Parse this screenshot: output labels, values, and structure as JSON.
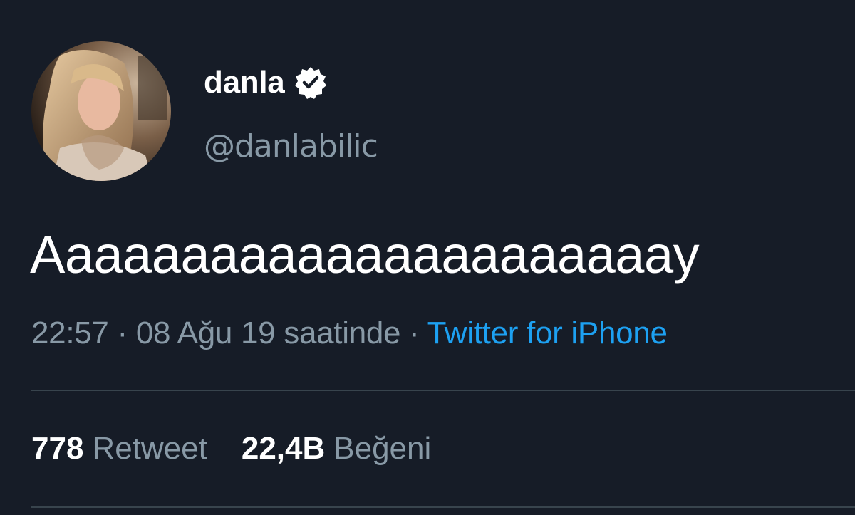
{
  "user": {
    "display_name": "danla",
    "handle": "@danlabilic",
    "verified": true,
    "avatar_icon": "profile-photo"
  },
  "tweet": {
    "text": "Aaaaaaaaaaaaaaaaaaaaaay",
    "time": "22:57",
    "separator": "·",
    "date": "08 Ağu 19 saatinde",
    "source": "Twitter for iPhone"
  },
  "stats": {
    "retweets": {
      "count": "778",
      "label": "Retweet"
    },
    "likes": {
      "count": "22,4B",
      "label": "Beğeni"
    }
  },
  "colors": {
    "background": "#161c27",
    "primary_text": "#ffffff",
    "secondary_text": "#8899a6",
    "link": "#1da1f2",
    "divider": "#38444d"
  }
}
